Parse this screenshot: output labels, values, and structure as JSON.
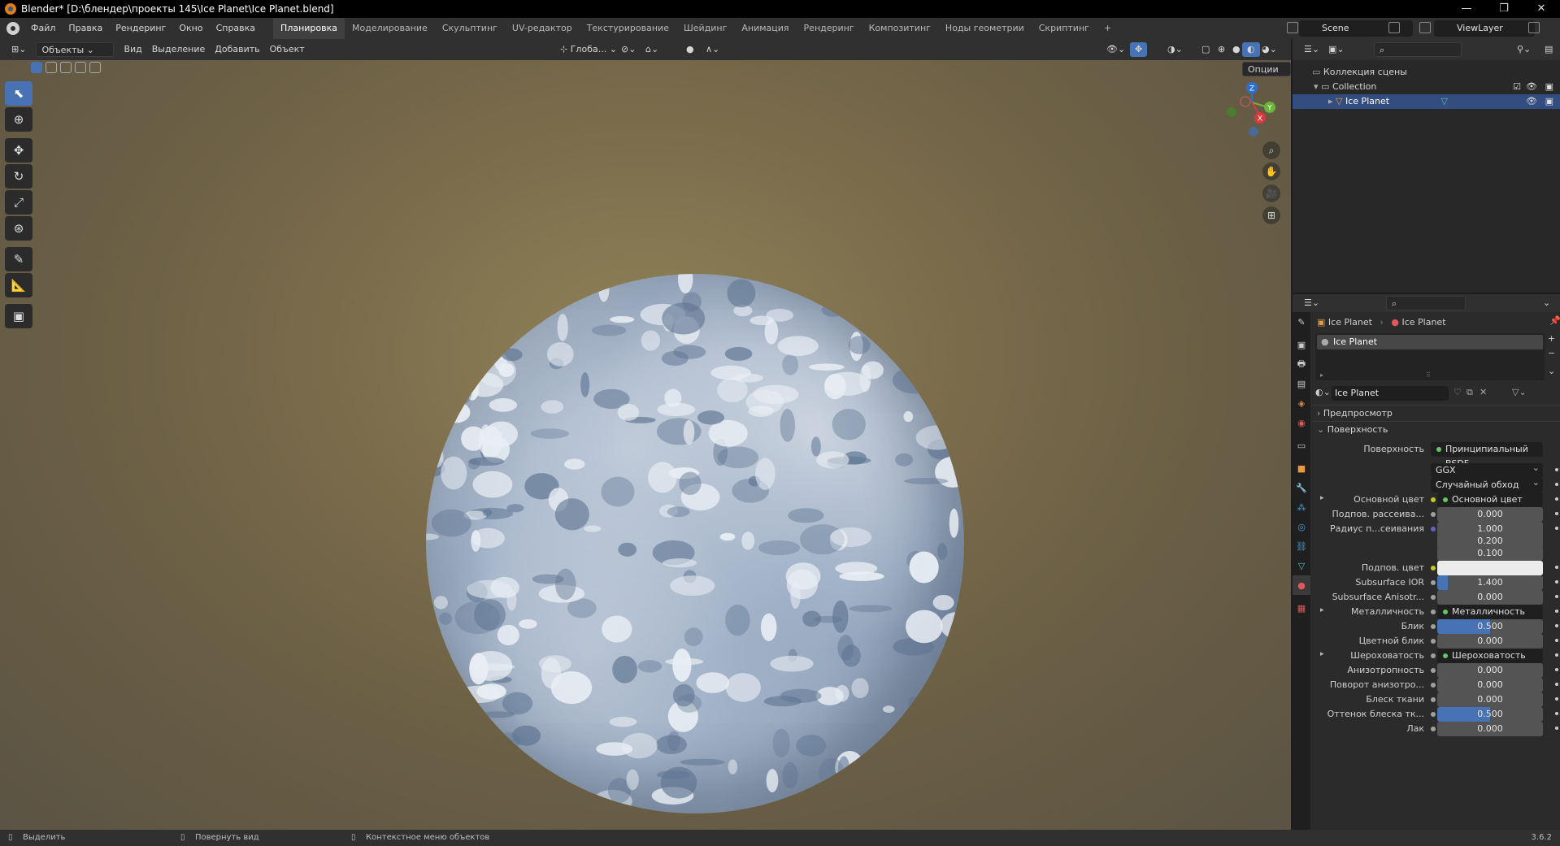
{
  "window": {
    "title": "Blender* [D:\\блендер\\проекты 145\\Ice Planet\\Ice Planet.blend]",
    "minimize": "—",
    "maximize": "❐",
    "close": "✕"
  },
  "menu": [
    "Файл",
    "Правка",
    "Рендеринг",
    "Окно",
    "Справка"
  ],
  "workspaces": [
    "Планировка",
    "Моделирование",
    "Скульптинг",
    "UV-редактор",
    "Текстурирование",
    "Шейдинг",
    "Анимация",
    "Рендеринг",
    "Композитинг",
    "Ноды геометрии",
    "Скриптинг",
    "+"
  ],
  "active_workspace": "Планировка",
  "scene": {
    "name": "Scene",
    "view_layer": "ViewLayer"
  },
  "viewport": {
    "mode": "Объекты",
    "menus": [
      "Вид",
      "Выделение",
      "Добавить",
      "Объект"
    ],
    "transform_orientation": "Глоба...",
    "options_label": "Опции",
    "gizmo_axes": {
      "z": "Z",
      "y": "Y",
      "x": "X"
    },
    "tools": [
      "select-box",
      "cursor",
      "move",
      "rotate",
      "scale",
      "transform",
      "annotate",
      "measure",
      "add-cube"
    ]
  },
  "outliner": {
    "root": "Коллекция сцены",
    "collection": "Collection",
    "object": "Ice Planet"
  },
  "properties": {
    "breadcrumb_object": "Ice Planet",
    "breadcrumb_material": "Ice Planet",
    "slot_name": "Ice Planet",
    "material_name": "Ice Planet",
    "sections": {
      "preview": "Предпросмотр",
      "surface": "Поверхность"
    },
    "surface_label": "Поверхность",
    "surface_shader": "Принципиальный BSDF",
    "distribution": "GGX",
    "subsurface_method": "Случайный обход",
    "rows": [
      {
        "label": "Основной цвет",
        "type": "link",
        "value": "Основной цвет",
        "dot": "#c7c729",
        "expand": true
      },
      {
        "label": "Подпов. рассеива...",
        "type": "num",
        "value": "0.000",
        "fill": 0,
        "dot": "#a1a1a1"
      },
      {
        "label": "Радиус п...сеивания",
        "type": "num",
        "value": "1.000",
        "fill": 0,
        "dot": "#6363c7"
      },
      {
        "label": "",
        "type": "num",
        "value": "0.200",
        "fill": 0,
        "dot": ""
      },
      {
        "label": "",
        "type": "num",
        "value": "0.100",
        "fill": 0,
        "dot": ""
      },
      {
        "label": "Подпов. цвет",
        "type": "color",
        "value": "",
        "dot": "#c7c729"
      },
      {
        "label": "Subsurface IOR",
        "type": "num",
        "value": "1.400",
        "fill": 0.1,
        "dot": "#a1a1a1"
      },
      {
        "label": "Subsurface Anisotr...",
        "type": "num",
        "value": "0.000",
        "fill": 0,
        "dot": "#a1a1a1"
      },
      {
        "label": "Металличность",
        "type": "link",
        "value": "Металличность",
        "dot": "#a1a1a1",
        "expand": true
      },
      {
        "label": "Блик",
        "type": "num",
        "value": "0.500",
        "fill": 0.5,
        "dot": "#a1a1a1"
      },
      {
        "label": "Цветной блик",
        "type": "num",
        "value": "0.000",
        "fill": 0,
        "dot": "#a1a1a1"
      },
      {
        "label": "Шероховатость",
        "type": "link",
        "value": "Шероховатость",
        "dot": "#a1a1a1",
        "expand": true
      },
      {
        "label": "Анизотропность",
        "type": "num",
        "value": "0.000",
        "fill": 0,
        "dot": "#a1a1a1"
      },
      {
        "label": "Поворот анизотро...",
        "type": "num",
        "value": "0.000",
        "fill": 0,
        "dot": "#a1a1a1"
      },
      {
        "label": "Блеск ткани",
        "type": "num",
        "value": "0.000",
        "fill": 0,
        "dot": "#a1a1a1"
      },
      {
        "label": "Оттенок блеска тк...",
        "type": "num",
        "value": "0.500",
        "fill": 0.5,
        "dot": "#a1a1a1"
      },
      {
        "label": "Лак",
        "type": "num",
        "value": "0.000",
        "fill": 0,
        "dot": "#a1a1a1"
      }
    ]
  },
  "status": {
    "left": "Выделить",
    "middle": "Повернуть вид",
    "right": "Контекстное меню объектов",
    "version": "3.6.2"
  },
  "colors": {
    "accent": "#4772b3",
    "selected_row": "#334d80",
    "header": "#303030"
  }
}
